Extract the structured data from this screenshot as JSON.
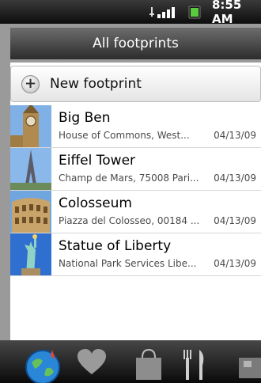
{
  "status_bar": {
    "time": "8:55 AM",
    "icons": [
      "sync-icon",
      "signal-icon",
      "battery-icon"
    ]
  },
  "header": {
    "title": "All footprints"
  },
  "new_item": {
    "label": "New footprint",
    "icon": "plus-icon"
  },
  "items": [
    {
      "title": "Big Ben",
      "subtitle": "House of Commons, West...",
      "date": "04/13/09",
      "thumb": "big-ben-photo"
    },
    {
      "title": "Eiffel Tower",
      "subtitle": "Champ de Mars, 75008 Pari...",
      "date": "04/13/09",
      "thumb": "eiffel-tower-photo"
    },
    {
      "title": "Colosseum",
      "subtitle": "Piazza del Colosseo, 00184 ...",
      "date": "04/13/09",
      "thumb": "colosseum-photo"
    },
    {
      "title": "Statue of Liberty",
      "subtitle": "National Park Services Libe...",
      "date": "04/13/09",
      "thumb": "statue-of-liberty-photo"
    }
  ],
  "bottom_nav": [
    "globe-icon",
    "heart-icon",
    "shopping-bag-icon",
    "fork-knife-icon",
    "more-icon"
  ],
  "colors": {
    "title_bar": "#2c2c2c",
    "battery_green": "#5ac93e",
    "globe_blue": "#2a86d6"
  }
}
